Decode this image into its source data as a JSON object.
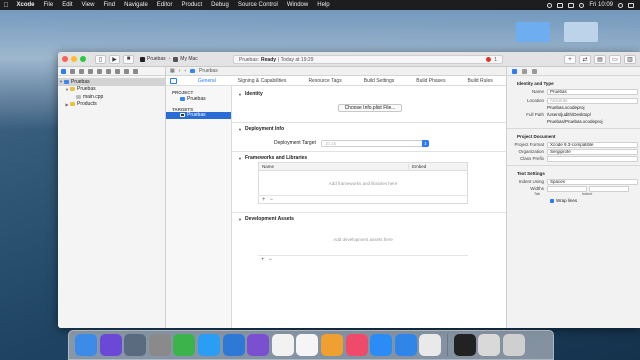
{
  "menubar": {
    "items": [
      "Xcode",
      "File",
      "Edit",
      "View",
      "Find",
      "Navigate",
      "Editor",
      "Product",
      "Debug",
      "Source Control",
      "Window",
      "Help"
    ],
    "clock": "Fri 10:09"
  },
  "toolbar": {
    "scheme": "Pruebas",
    "destination": "My Mac",
    "status_app": "Pruebas:",
    "status_ready": "Ready",
    "status_time": "| Today at 19:29",
    "status_issues": "1"
  },
  "navigator": {
    "project": "Pruebas",
    "group": "Pruebas",
    "file": "main.cpp",
    "products": "Products"
  },
  "jumpbar": {
    "crumb": "Pruebas"
  },
  "editor": {
    "tabs": [
      "General",
      "Signing & Capabilities",
      "Resource Tags",
      "Build Settings",
      "Build Phases",
      "Build Rules"
    ],
    "project_header": "PROJECT",
    "project_item": "Pruebas",
    "targets_header": "TARGETS",
    "target_item": "Pruebas",
    "identity": {
      "title": "Identity",
      "button": "Choose Info.plist File..."
    },
    "deployment": {
      "title": "Deployment Info",
      "label": "Deployment Target",
      "value": "10.15"
    },
    "frameworks": {
      "title": "Frameworks and Libraries",
      "col_name": "Name",
      "col_embed": "Embed",
      "empty": "Add frameworks and libraries here",
      "plus": "+",
      "minus": "−"
    },
    "assets": {
      "title": "Development Assets",
      "empty": "Add development assets here",
      "plus": "+",
      "minus": "−"
    }
  },
  "inspector": {
    "identity_title": "Identity and Type",
    "name_label": "Name",
    "name_value": "Pruebas",
    "location_label": "Location",
    "location_value": "Absolute",
    "file_value": "Pruebas.xcodeproj",
    "fullpath_label": "Full Path",
    "fullpath_value1": "/Users/judith/Desktop/",
    "fullpath_value2": "Pruebas/Pruebas.xcodeproj",
    "projdoc_title": "Project Document",
    "format_label": "Project Format",
    "format_value": "Xcode 9.3-compatible",
    "org_label": "Organization",
    "org_value": "Sergiprofe",
    "prefix_label": "Class Prefix",
    "prefix_value": "",
    "text_title": "Text Settings",
    "indent_label": "Indent Using",
    "indent_value": "Spaces",
    "widths_label": "Widths",
    "tab_label": "Tab",
    "indent_sub": "Indent",
    "wrap_label": "Wrap lines"
  },
  "dock": {
    "apps": [
      {
        "name": "finder",
        "color": "#3d8be8"
      },
      {
        "name": "siri",
        "color": "#6b48d6"
      },
      {
        "name": "launchpad",
        "color": "#5a6b80"
      },
      {
        "name": "system-preferences",
        "color": "#8a8a8a"
      },
      {
        "name": "notes-green",
        "color": "#3cb44b"
      },
      {
        "name": "xcode-instruments",
        "color": "#2a9df4"
      },
      {
        "name": "pages",
        "color": "#2f79d6"
      },
      {
        "name": "imovie",
        "color": "#7a4fd0"
      },
      {
        "name": "calendar",
        "color": "#f2f2f2"
      },
      {
        "name": "reminders",
        "color": "#f5f5f5"
      },
      {
        "name": "photos",
        "color": "#f0a030"
      },
      {
        "name": "itunes",
        "color": "#f04a6a"
      },
      {
        "name": "app-store",
        "color": "#2b8cf5"
      },
      {
        "name": "xcode",
        "color": "#2f86e8"
      },
      {
        "name": "chrome",
        "color": "#e9e9e9"
      },
      {
        "name": "terminal",
        "color": "#222222"
      },
      {
        "name": "preview",
        "color": "#d9d9d9"
      },
      {
        "name": "trash",
        "color": "#cfcfcf"
      }
    ]
  }
}
